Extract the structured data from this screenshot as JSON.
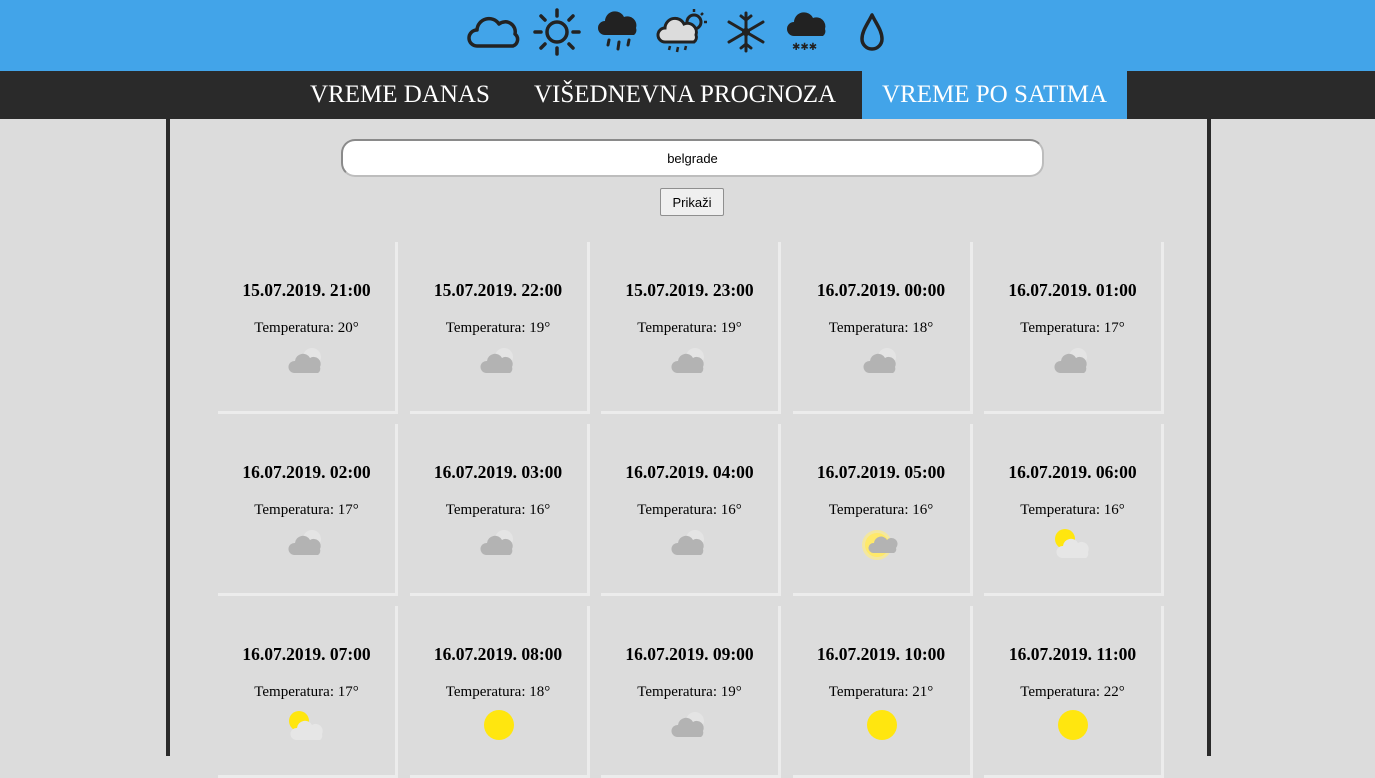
{
  "header": {
    "icons": [
      "cloud-icon",
      "sun-icon",
      "rain-icon",
      "sun-cloud-rain-icon",
      "snowflake-icon",
      "snow-cloud-icon",
      "drop-icon"
    ]
  },
  "nav": {
    "items": [
      {
        "label": "VREME DANAS"
      },
      {
        "label": "VIŠEDNEVNA PROGNOZA"
      },
      {
        "label": "VREME PO SATIMA"
      }
    ],
    "active": "VREME PO SATIMA"
  },
  "search": {
    "value": "belgrade",
    "button_label": "Prikaži"
  },
  "forecast": [
    {
      "datetime": "15.07.2019. 21:00",
      "temp": "Temperatura: 20°",
      "icon": "cloud"
    },
    {
      "datetime": "15.07.2019. 22:00",
      "temp": "Temperatura: 19°",
      "icon": "cloud"
    },
    {
      "datetime": "15.07.2019. 23:00",
      "temp": "Temperatura: 19°",
      "icon": "cloud"
    },
    {
      "datetime": "16.07.2019. 00:00",
      "temp": "Temperatura: 18°",
      "icon": "cloud"
    },
    {
      "datetime": "16.07.2019. 01:00",
      "temp": "Temperatura: 17°",
      "icon": "cloud"
    },
    {
      "datetime": "16.07.2019. 02:00",
      "temp": "Temperatura: 17°",
      "icon": "cloud"
    },
    {
      "datetime": "16.07.2019. 03:00",
      "temp": "Temperatura: 16°",
      "icon": "cloud"
    },
    {
      "datetime": "16.07.2019. 04:00",
      "temp": "Temperatura: 16°",
      "icon": "cloud"
    },
    {
      "datetime": "16.07.2019. 05:00",
      "temp": "Temperatura: 16°",
      "icon": "sun-behind-cloud"
    },
    {
      "datetime": "16.07.2019. 06:00",
      "temp": "Temperatura: 16°",
      "icon": "partly-sunny"
    },
    {
      "datetime": "16.07.2019. 07:00",
      "temp": "Temperatura: 17°",
      "icon": "partly-sunny"
    },
    {
      "datetime": "16.07.2019. 08:00",
      "temp": "Temperatura: 18°",
      "icon": "sun"
    },
    {
      "datetime": "16.07.2019. 09:00",
      "temp": "Temperatura: 19°",
      "icon": "cloud"
    },
    {
      "datetime": "16.07.2019. 10:00",
      "temp": "Temperatura: 21°",
      "icon": "sun"
    },
    {
      "datetime": "16.07.2019. 11:00",
      "temp": "Temperatura: 22°",
      "icon": "sun"
    }
  ],
  "colors": {
    "header": "#42a4e9",
    "nav": "#2a2a2a",
    "sun": "#ffe60f",
    "cloud": "#b3b3b3"
  }
}
